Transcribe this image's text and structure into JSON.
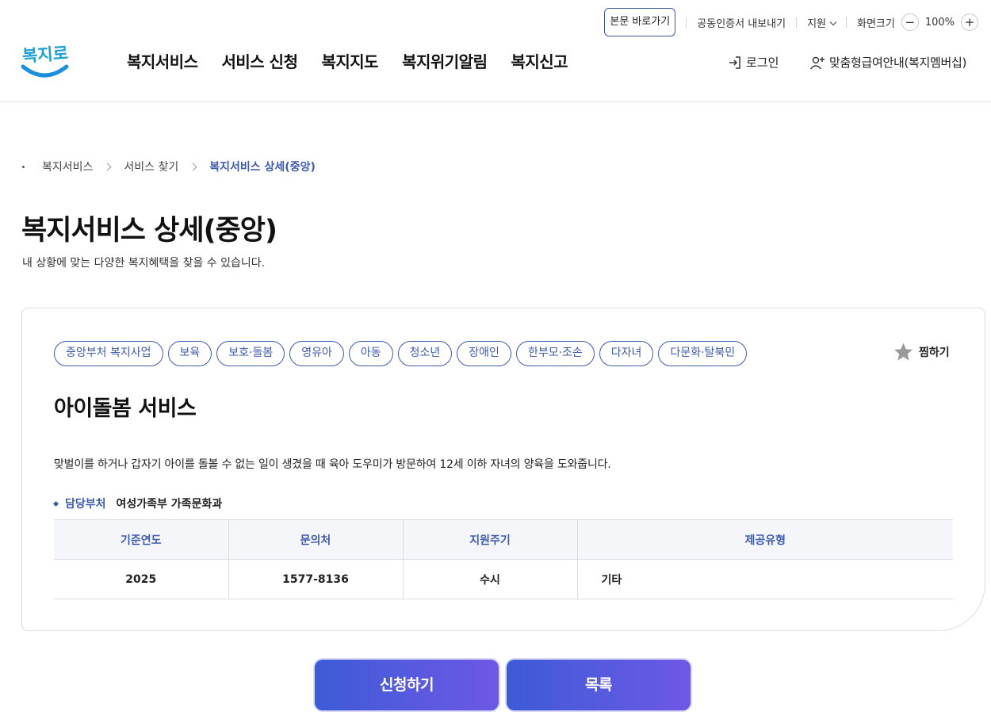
{
  "header": {
    "logo_text": "복지로",
    "util": {
      "skip_link": "본문 바로가기",
      "cert_export": "공동인증서 내보내기",
      "support": "지원",
      "screen_size": "화면크기",
      "zoom_minus": "−",
      "zoom_value": "100%",
      "zoom_plus": "+"
    },
    "nav": [
      "복지서비스",
      "서비스 신청",
      "복지지도",
      "복지위기알림",
      "복지신고"
    ],
    "login": "로그인",
    "membership": "맞춤형급여안내(복지멤버십)"
  },
  "breadcrumb": [
    "복지서비스",
    "서비스 찾기",
    "복지서비스 상세(중앙)"
  ],
  "page": {
    "title": "복지서비스 상세(중앙)",
    "description": "내 상황에 맞는 다양한 복지혜택을 찾을 수 있습니다."
  },
  "service": {
    "tags": [
      "중앙부처 복지사업",
      "보육",
      "보호·돌봄",
      "영유아",
      "아동",
      "청소년",
      "장애인",
      "한부모·조손",
      "다자녀",
      "다문화·탈북민"
    ],
    "favorite_label": "찜하기",
    "title": "아이돌봄 서비스",
    "description": "맞벌이를 하거나 갑자기 아이를 돌볼 수 없는 일이 생겼을 때 육아 도우미가 방문하여 12세 이하 자녀의 양육을 도와줍니다.",
    "department_label": "담당부처",
    "department": "여성가족부 가족문화과",
    "table": {
      "headers": [
        "기준연도",
        "문의처",
        "지원주기",
        "제공유형"
      ],
      "row": [
        "2025",
        "1577-8136",
        "수시",
        "기타"
      ]
    }
  },
  "buttons": {
    "apply": "신청하기",
    "list": "목록"
  },
  "colors": {
    "accent": "#3f5bb0",
    "button_gradient_start": "#3d5bd6",
    "button_gradient_end": "#6e58e6",
    "logo_text": "#1aa0d6",
    "logo_smile": "#1a8fe0"
  },
  "icons": {
    "login": "login-arrow-icon",
    "membership": "user-plus-icon",
    "favorite": "star-icon"
  }
}
